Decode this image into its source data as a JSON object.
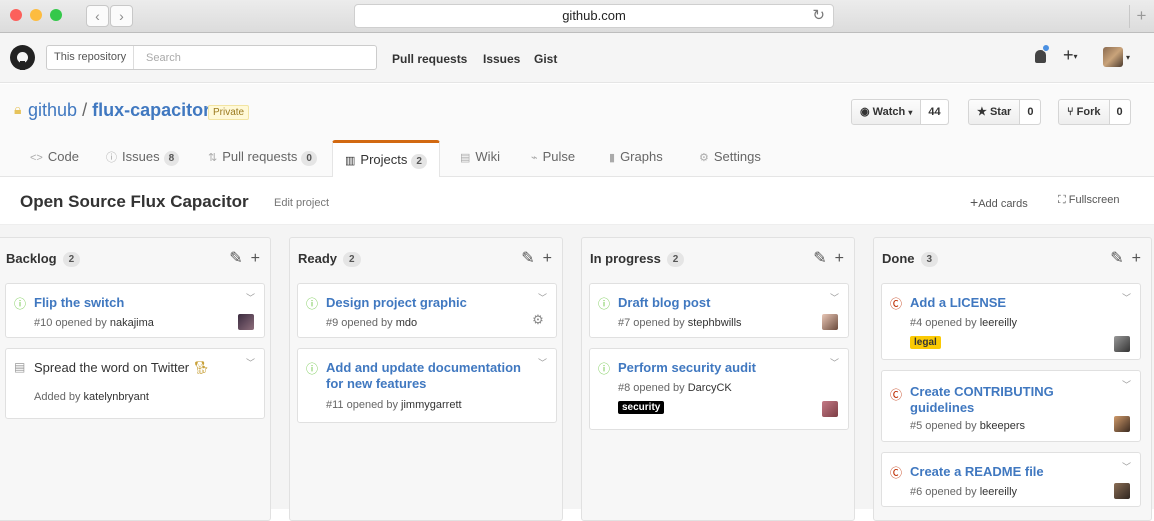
{
  "browser": {
    "url": "github.com"
  },
  "header": {
    "scope": "This repository",
    "search_placeholder": "Search",
    "nav": [
      "Pull requests",
      "Issues",
      "Gist"
    ]
  },
  "repo": {
    "owner": "github",
    "separator": "/",
    "name": "flux-capacitor",
    "visibility": "Private",
    "watch": {
      "label": "Watch",
      "count": "44"
    },
    "star": {
      "label": "Star",
      "count": "0"
    },
    "fork": {
      "label": "Fork",
      "count": "0"
    }
  },
  "tabs": [
    {
      "label": "Code",
      "icon": "code-icon"
    },
    {
      "label": "Issues",
      "count": "8",
      "icon": "issue-icon"
    },
    {
      "label": "Pull requests",
      "count": "0",
      "icon": "pull-request-icon"
    },
    {
      "label": "Projects",
      "count": "2",
      "icon": "project-icon"
    },
    {
      "label": "Wiki",
      "icon": "book-icon"
    },
    {
      "label": "Pulse",
      "icon": "pulse-icon"
    },
    {
      "label": "Graphs",
      "icon": "graph-icon"
    },
    {
      "label": "Settings",
      "icon": "gear-icon"
    }
  ],
  "project": {
    "title": "Open Source Flux Capacitor",
    "edit": "Edit project",
    "add_cards": "Add cards",
    "fullscreen": "Fullscreen"
  },
  "columns": [
    {
      "name": "Backlog",
      "count": "2",
      "cards": [
        {
          "title": "Flip the switch",
          "meta_prefix": "#10 opened by",
          "user": "nakajima"
        },
        {
          "title": "Spread the word on Twitter",
          "meta_prefix": "Added by",
          "user": "katelynbryant"
        }
      ]
    },
    {
      "name": "Ready",
      "count": "2",
      "cards": [
        {
          "title": "Design project graphic",
          "meta_prefix": "#9 opened by",
          "user": "mdo"
        },
        {
          "title": "Add and update documentation for new features",
          "meta_prefix": "#11 opened by",
          "user": "jimmygarrett"
        }
      ]
    },
    {
      "name": "In progress",
      "count": "2",
      "cards": [
        {
          "title": "Draft blog post",
          "meta_prefix": "#7 opened by",
          "user": "stephbwills"
        },
        {
          "title": "Perform security audit",
          "meta_prefix": "#8 opened by",
          "user": "DarcyCK",
          "label": "security"
        }
      ]
    },
    {
      "name": "Done",
      "count": "3",
      "cards": [
        {
          "title": "Add a LICENSE",
          "meta_prefix": "#4 opened by",
          "user": "leereilly",
          "label": "legal"
        },
        {
          "title": "Create CONTRIBUTING guidelines",
          "meta_prefix": "#5 opened by",
          "user": "bkeepers"
        },
        {
          "title": "Create a README file",
          "meta_prefix": "#6 opened by",
          "user": "leereilly"
        }
      ]
    }
  ],
  "colors": {
    "link": "#4078c0",
    "open": "#6cc644",
    "closed": "#bd2c00",
    "accent": "#d26911",
    "legal": "#fbca04",
    "security": "#000000"
  }
}
